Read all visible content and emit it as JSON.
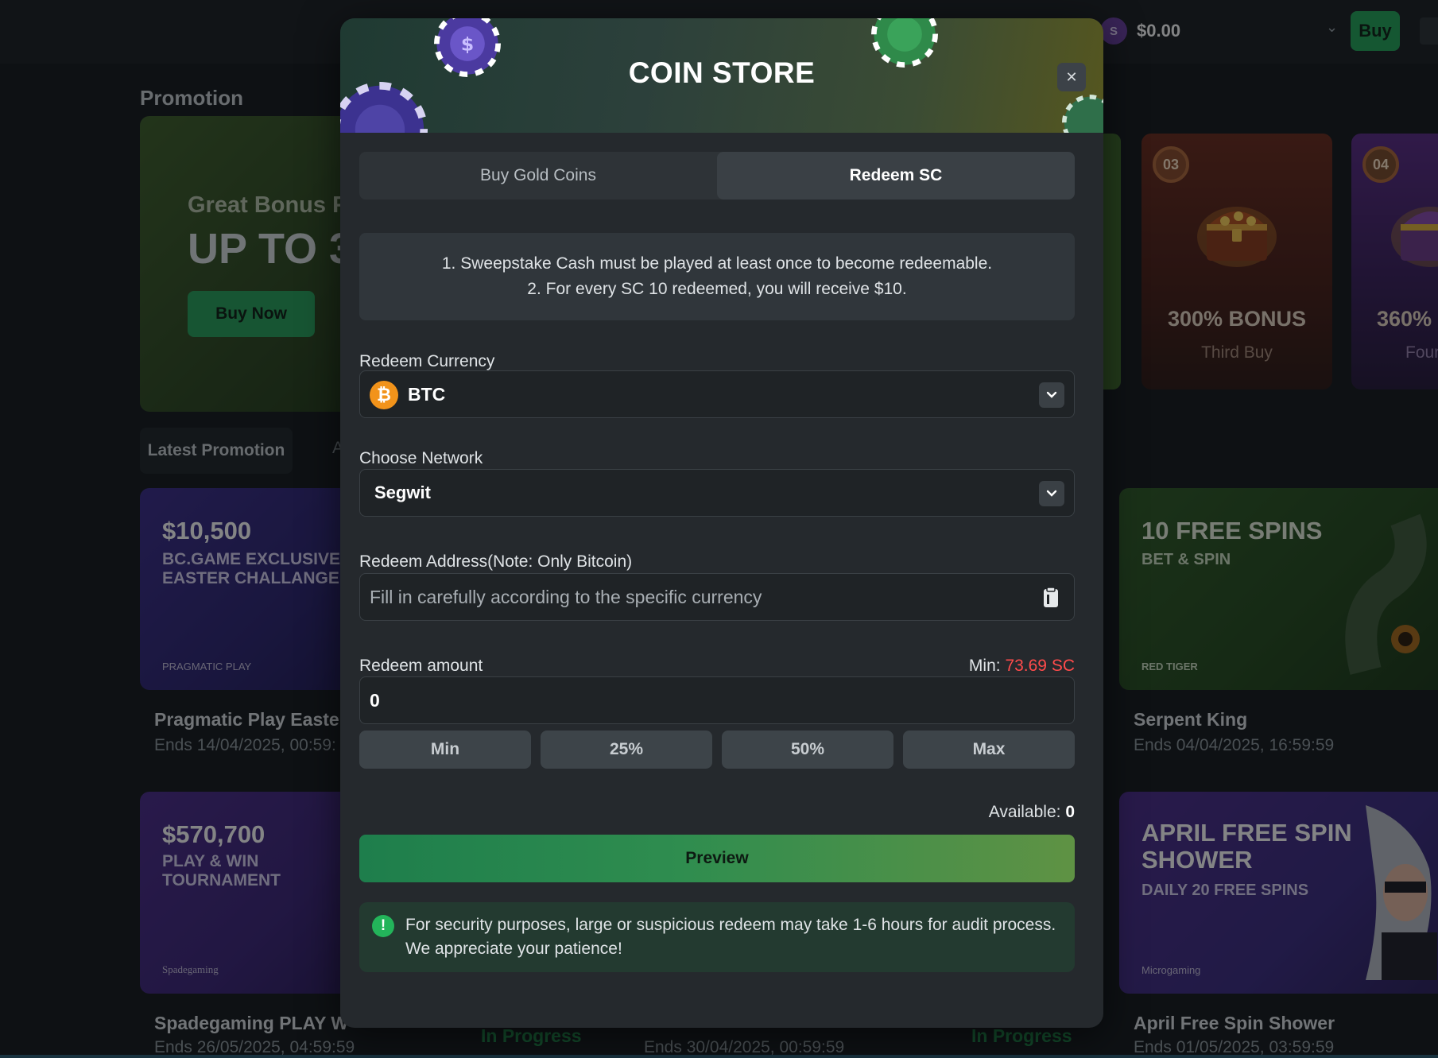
{
  "topbar": {
    "balance": "$0.00",
    "currency_icon": "sweep-coin-icon",
    "buy_label": "Buy"
  },
  "page": {
    "section_title": "Promotion",
    "hero": {
      "subtitle": "Great Bonus F",
      "headline": "UP TO 3",
      "button_label": "Buy Now"
    },
    "promo_tabs": [
      "Latest Promotion",
      "A"
    ],
    "bonus_cards": [
      {
        "badge": "03",
        "title": "300% BONUS",
        "subtitle": "Third Buy"
      },
      {
        "badge": "04",
        "title": "360%",
        "subtitle": "Four"
      }
    ],
    "events": [
      {
        "amount": "$10,500",
        "line1": "BC.GAME EXCLUSIVE",
        "line2": "EASTER CHALLANGE",
        "provider": "PRAGMATIC PLAY",
        "name": "Pragmatic Play Easte",
        "date": "Ends 14/04/2025, 00:59:"
      },
      {
        "amount": "10 FREE SPINS",
        "line1": "BET & SPIN",
        "line2": "",
        "provider": "RED TIGER",
        "name": "Serpent King",
        "date": "Ends 04/04/2025, 16:59:59"
      },
      {
        "amount": "$570,700",
        "line1": "PLAY & WIN",
        "line2": "TOURNAMENT",
        "provider": "Spadegaming",
        "name": "Spadegaming PLAY W",
        "date": "Ends 26/05/2025, 04:59:59",
        "status": "In Progress"
      },
      {
        "amount": "",
        "line1": "",
        "line2": "",
        "provider": "",
        "name": "",
        "date": "Ends 30/04/2025, 00:59:59",
        "status": "In Progress"
      },
      {
        "amount": "APRIL FREE SPIN",
        "line1": "SHOWER",
        "line2": "DAILY 20 FREE SPINS",
        "provider": "Microgaming",
        "name": "April Free Spin Shower",
        "date": "Ends 01/05/2025, 03:59:59"
      }
    ]
  },
  "modal": {
    "title": "COIN STORE",
    "close_icon": "close-icon",
    "tabs": [
      {
        "label": "Buy Gold Coins",
        "active": false
      },
      {
        "label": "Redeem SC",
        "active": true
      }
    ],
    "notice": [
      "1. Sweepstake Cash must be played at least once to become redeemable.",
      "2. For every SC 10 redeemed, you will receive $10."
    ],
    "currency": {
      "label": "Redeem Currency",
      "value": "BTC",
      "icon": "bitcoin-icon"
    },
    "network": {
      "label": "Choose Network",
      "value": "Segwit"
    },
    "address": {
      "label": "Redeem Address(Note: Only Bitcoin)",
      "placeholder": "Fill in carefully according to the specific currency",
      "value": ""
    },
    "amount": {
      "label": "Redeem amount",
      "min_prefix": "Min:",
      "min_value": "73.69 SC",
      "value": "0"
    },
    "quick_buttons": [
      "Min",
      "25%",
      "50%",
      "Max"
    ],
    "available_label": "Available:",
    "available_value": "0",
    "preview_label": "Preview",
    "security_message": "For security purposes, large or suspicious redeem may take 1-6 hours for audit process. We appreciate your patience!"
  },
  "colors": {
    "accent_green": "#23a559",
    "min_value_red": "#ff4b4b",
    "modal_bg": "#25292d"
  }
}
